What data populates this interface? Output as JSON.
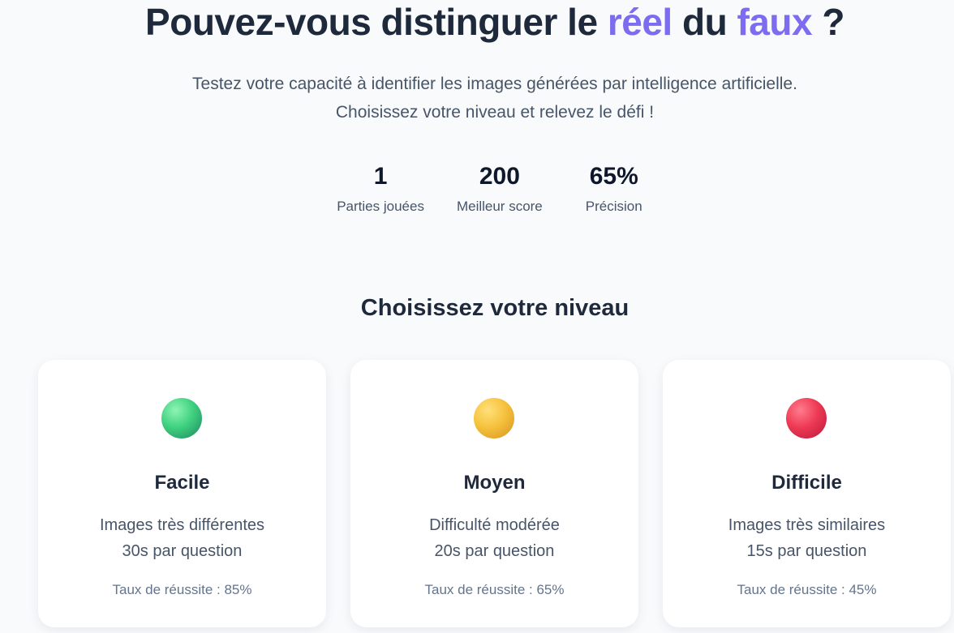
{
  "hero": {
    "title_part1": "Pouvez-vous distinguer le ",
    "title_accent1": "réel",
    "title_part2": " du ",
    "title_accent2": "faux",
    "title_part3": " ?",
    "subtitle": "Testez votre capacité à identifier les images générées par intelligence artificielle. Choisissez votre niveau et relevez le défi !"
  },
  "stats": [
    {
      "value": "1",
      "label": "Parties jouées"
    },
    {
      "value": "200",
      "label": "Meilleur score"
    },
    {
      "value": "65%",
      "label": "Précision"
    }
  ],
  "levels_section": {
    "title": "Choisissez votre niveau"
  },
  "levels": [
    {
      "title": "Facile",
      "line1": "Images très différentes",
      "line2": "30s par question",
      "rate": "Taux de réussite : 85%",
      "orb_color": "#3fd180"
    },
    {
      "title": "Moyen",
      "line1": "Difficulté modérée",
      "line2": "20s par question",
      "rate": "Taux de réussite : 65%",
      "orb_color": "#f6c23e"
    },
    {
      "title": "Difficile",
      "line1": "Images très similaires",
      "line2": "15s par question",
      "rate": "Taux de réussite : 45%",
      "orb_color": "#ee3a55"
    }
  ],
  "colors": {
    "accent": "#7c6cf0",
    "background": "#f8fafc",
    "text_primary": "#1e293b",
    "text_secondary": "#475569"
  }
}
